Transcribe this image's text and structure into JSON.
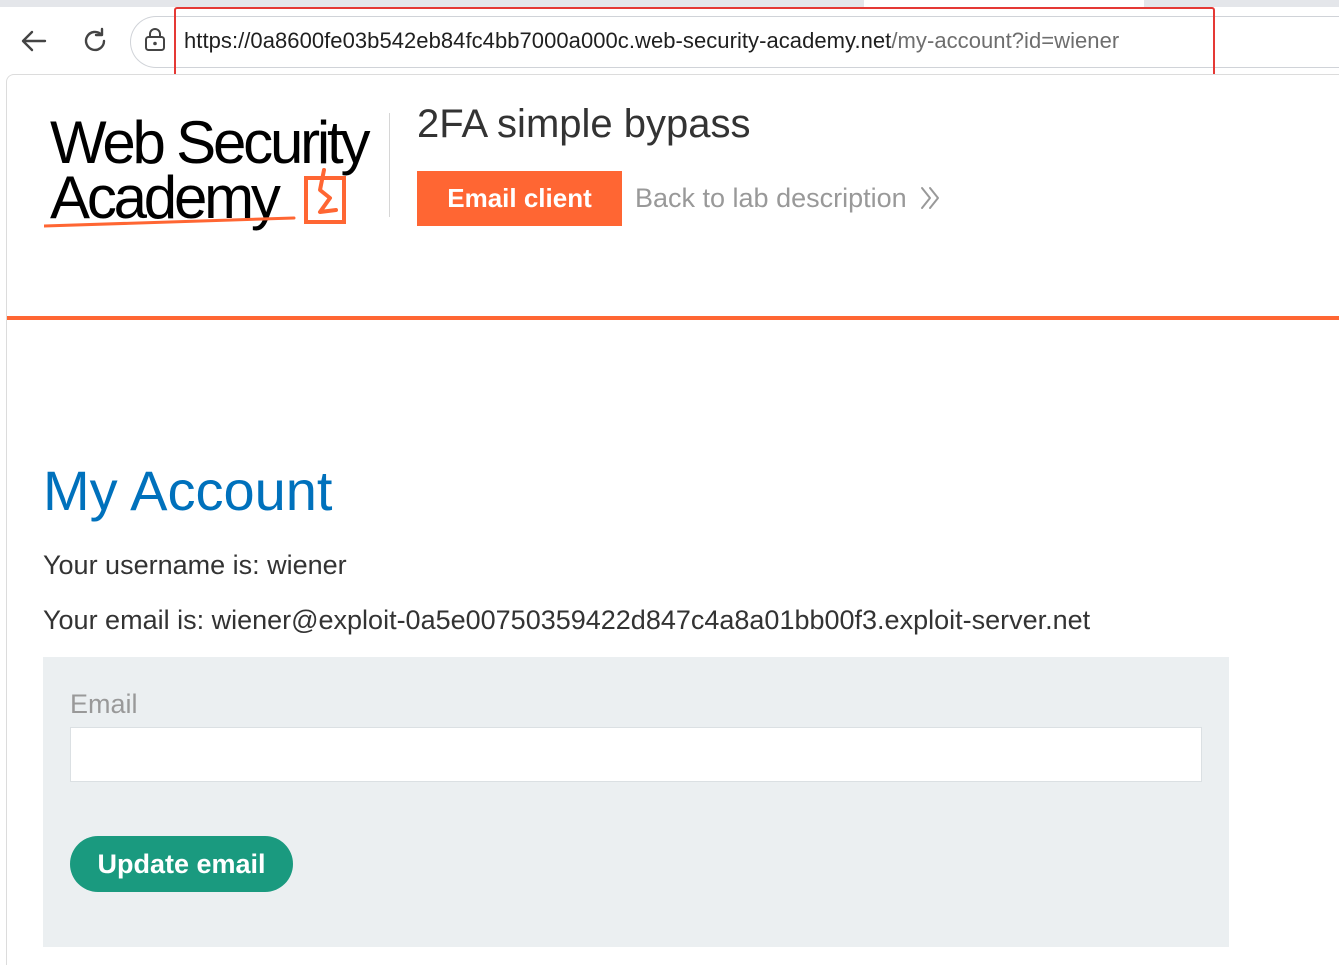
{
  "browser": {
    "url_host": "https://0a8600fe03b542eb84fc4bb7000a000c.web-security-academy.net",
    "url_path": "/my-account?id=wiener"
  },
  "header": {
    "logo_line1": "Web Security",
    "logo_line2": "Academy",
    "lab_title": "2FA simple bypass",
    "email_client_label": "Email client",
    "back_link_label": "Back to lab description",
    "accent_color": "#ff6633"
  },
  "account": {
    "heading": "My Account",
    "username_line": "Your username is: wiener",
    "email_line": "Your email is: wiener@exploit-0a5e00750359422d847c4a8a01bb00f3.exploit-server.net",
    "heading_color": "#0071bc"
  },
  "form": {
    "email_label": "Email",
    "email_value": "",
    "submit_label": "Update email",
    "submit_color": "#1a9a7f"
  },
  "icons": [
    "back-arrow-icon",
    "reload-icon",
    "lock-icon",
    "double-chevron-right-icon",
    "logo-lightning-icon"
  ]
}
